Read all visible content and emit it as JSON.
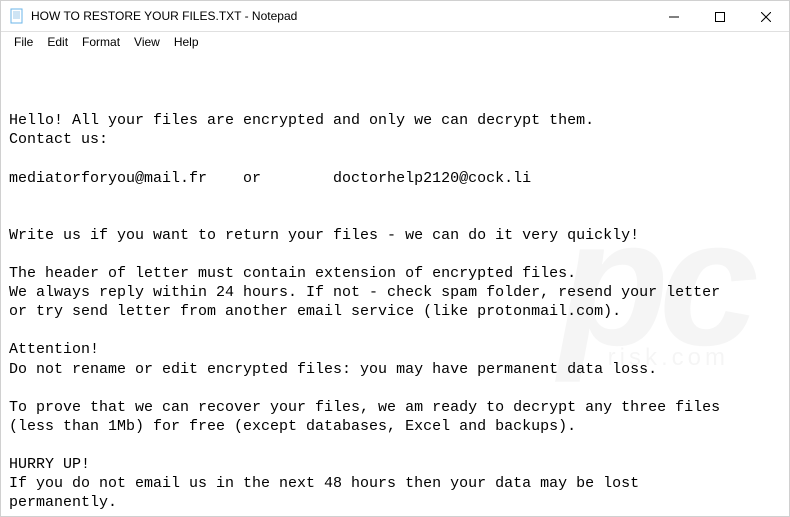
{
  "window": {
    "title": "HOW TO RESTORE YOUR FILES.TXT - Notepad"
  },
  "menu": {
    "file": "File",
    "edit": "Edit",
    "format": "Format",
    "view": "View",
    "help": "Help"
  },
  "content": {
    "line1": "Hello! All your files are encrypted and only we can decrypt them.",
    "line2": "Contact us:",
    "line3": "",
    "line4": "mediatorforyou@mail.fr    or        doctorhelp2120@cock.li",
    "line5": "",
    "line6": "",
    "line7": "Write us if you want to return your files - we can do it very quickly!",
    "line8": "",
    "line9": "The header of letter must contain extension of encrypted files.",
    "line10": "We always reply within 24 hours. If not - check spam folder, resend your letter",
    "line11": "or try send letter from another email service (like protonmail.com).",
    "line12": "",
    "line13": "Attention!",
    "line14": "Do not rename or edit encrypted files: you may have permanent data loss.",
    "line15": "",
    "line16": "To prove that we can recover your files, we am ready to decrypt any three files",
    "line17": "(less than 1Mb) for free (except databases, Excel and backups).",
    "line18": "",
    "line19": "HURRY UP!",
    "line20": "If you do not email us in the next 48 hours then your data may be lost",
    "line21": "permanently."
  },
  "watermark": {
    "main": "pc",
    "sub": "risk.com"
  }
}
